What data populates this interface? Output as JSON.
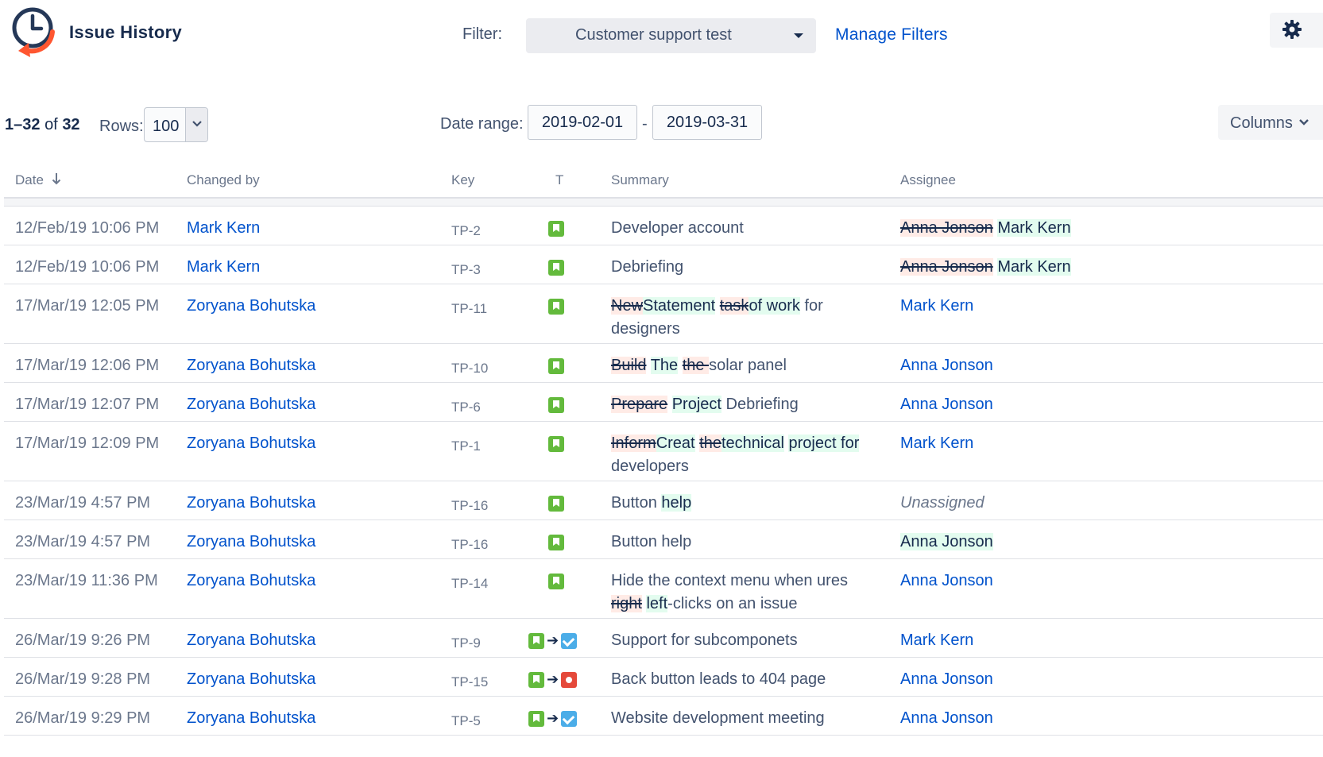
{
  "header": {
    "title": "Issue History",
    "filter_label": "Filter:",
    "filter_value": "Customer support test",
    "manage_filters": "Manage Filters"
  },
  "controls": {
    "range_start_end": "1–32",
    "range_of": "of",
    "range_total": "32",
    "rows_label": "Rows:",
    "rows_value": "100",
    "date_range_label": "Date range:",
    "date_from": "2019-02-01",
    "date_separator": "-",
    "date_to": "2019-03-31",
    "columns_label": "Columns"
  },
  "columns": {
    "date": "Date",
    "changed_by": "Changed by",
    "key": "Key",
    "type": "T",
    "summary": "Summary",
    "assignee": "Assignee"
  },
  "rows": [
    {
      "date": "12/Feb/19 10:06 PM",
      "changed_by": "Mark Kern",
      "key": "TP-2",
      "type": [
        "story"
      ],
      "summary": [
        {
          "t": "Developer account",
          "s": "plain"
        }
      ],
      "assignee": [
        {
          "t": "Anna Jonson",
          "s": "del"
        },
        {
          "t": " ",
          "s": "plain"
        },
        {
          "t": "Mark Kern",
          "s": "add"
        }
      ]
    },
    {
      "date": "12/Feb/19 10:06 PM",
      "changed_by": "Mark Kern",
      "key": "TP-3",
      "type": [
        "story"
      ],
      "summary": [
        {
          "t": "Debriefing",
          "s": "plain"
        }
      ],
      "assignee": [
        {
          "t": "Anna Jonson",
          "s": "del"
        },
        {
          "t": " ",
          "s": "plain"
        },
        {
          "t": "Mark Kern",
          "s": "add"
        }
      ]
    },
    {
      "date": "17/Mar/19 12:05 PM",
      "changed_by": "Zoryana Bohutska",
      "key": "TP-11",
      "type": [
        "story"
      ],
      "summary": [
        {
          "t": "New",
          "s": "del"
        },
        {
          "t": "Statement",
          "s": "add"
        },
        {
          "t": " ",
          "s": "plain"
        },
        {
          "t": "task",
          "s": "del"
        },
        {
          "t": "of work",
          "s": "add"
        },
        {
          "t": " for designers",
          "s": "plain"
        }
      ],
      "assignee": [
        {
          "t": "Mark Kern",
          "s": "link"
        }
      ]
    },
    {
      "date": "17/Mar/19 12:06 PM",
      "changed_by": "Zoryana Bohutska",
      "key": "TP-10",
      "type": [
        "story"
      ],
      "summary": [
        {
          "t": "Build",
          "s": "del"
        },
        {
          "t": " ",
          "s": "plain"
        },
        {
          "t": "The",
          "s": "add"
        },
        {
          "t": " ",
          "s": "plain"
        },
        {
          "t": "the ",
          "s": "del"
        },
        {
          "t": "solar panel",
          "s": "plain"
        }
      ],
      "assignee": [
        {
          "t": "Anna Jonson",
          "s": "link"
        }
      ]
    },
    {
      "date": "17/Mar/19 12:07 PM",
      "changed_by": "Zoryana Bohutska",
      "key": "TP-6",
      "type": [
        "story"
      ],
      "summary": [
        {
          "t": "Prepare",
          "s": "del"
        },
        {
          "t": " ",
          "s": "plain"
        },
        {
          "t": "Project",
          "s": "add"
        },
        {
          "t": " Debriefing",
          "s": "plain"
        }
      ],
      "assignee": [
        {
          "t": "Anna Jonson",
          "s": "link"
        }
      ]
    },
    {
      "date": "17/Mar/19 12:09 PM",
      "changed_by": "Zoryana Bohutska",
      "key": "TP-1",
      "type": [
        "story"
      ],
      "summary": [
        {
          "t": "Inform",
          "s": "del"
        },
        {
          "t": "Creat",
          "s": "add"
        },
        {
          "t": " ",
          "s": "plain"
        },
        {
          "t": "the",
          "s": "del"
        },
        {
          "t": "technical",
          "s": "add"
        },
        {
          "t": " ",
          "s": "plain"
        },
        {
          "t": "project for",
          "s": "add"
        },
        {
          "t": " developers",
          "s": "plain"
        }
      ],
      "assignee": [
        {
          "t": "Mark Kern",
          "s": "link"
        }
      ]
    },
    {
      "date": "23/Mar/19 4:57 PM",
      "changed_by": "Zoryana Bohutska",
      "key": "TP-16",
      "type": [
        "story"
      ],
      "summary": [
        {
          "t": "Button ",
          "s": "plain"
        },
        {
          "t": "help",
          "s": "add"
        }
      ],
      "assignee": [
        {
          "t": "Unassigned",
          "s": "unassigned"
        }
      ]
    },
    {
      "date": "23/Mar/19 4:57 PM",
      "changed_by": "Zoryana Bohutska",
      "key": "TP-16",
      "type": [
        "story"
      ],
      "summary": [
        {
          "t": "Button help",
          "s": "plain"
        }
      ],
      "assignee": [
        {
          "t": "Anna Jonson",
          "s": "add"
        }
      ]
    },
    {
      "date": "23/Mar/19 11:36 PM",
      "changed_by": "Zoryana Bohutska",
      "key": "TP-14",
      "type": [
        "story"
      ],
      "summary": [
        {
          "t": "Hide the context menu when ures ",
          "s": "plain"
        },
        {
          "t": "right",
          "s": "del"
        },
        {
          "t": " ",
          "s": "plain"
        },
        {
          "t": "left",
          "s": "add"
        },
        {
          "t": "-clicks on an issue",
          "s": "plain"
        }
      ],
      "assignee": [
        {
          "t": "Anna Jonson",
          "s": "link"
        }
      ]
    },
    {
      "date": "26/Mar/19 9:26 PM",
      "changed_by": "Zoryana Bohutska",
      "key": "TP-9",
      "type": [
        "story",
        "arrow",
        "task"
      ],
      "summary": [
        {
          "t": "Support for subcomponets",
          "s": "plain"
        }
      ],
      "assignee": [
        {
          "t": "Mark Kern",
          "s": "link"
        }
      ]
    },
    {
      "date": "26/Mar/19 9:28 PM",
      "changed_by": "Zoryana Bohutska",
      "key": "TP-15",
      "type": [
        "story",
        "arrow",
        "bug"
      ],
      "summary": [
        {
          "t": "Back button leads to 404 page",
          "s": "plain"
        }
      ],
      "assignee": [
        {
          "t": "Anna Jonson",
          "s": "link"
        }
      ]
    },
    {
      "date": "26/Mar/19 9:29 PM",
      "changed_by": "Zoryana Bohutska",
      "key": "TP-5",
      "type": [
        "story",
        "arrow",
        "task"
      ],
      "summary": [
        {
          "t": "Website development meeting",
          "s": "plain"
        }
      ],
      "assignee": [
        {
          "t": "Anna Jonson",
          "s": "link"
        }
      ]
    }
  ]
}
